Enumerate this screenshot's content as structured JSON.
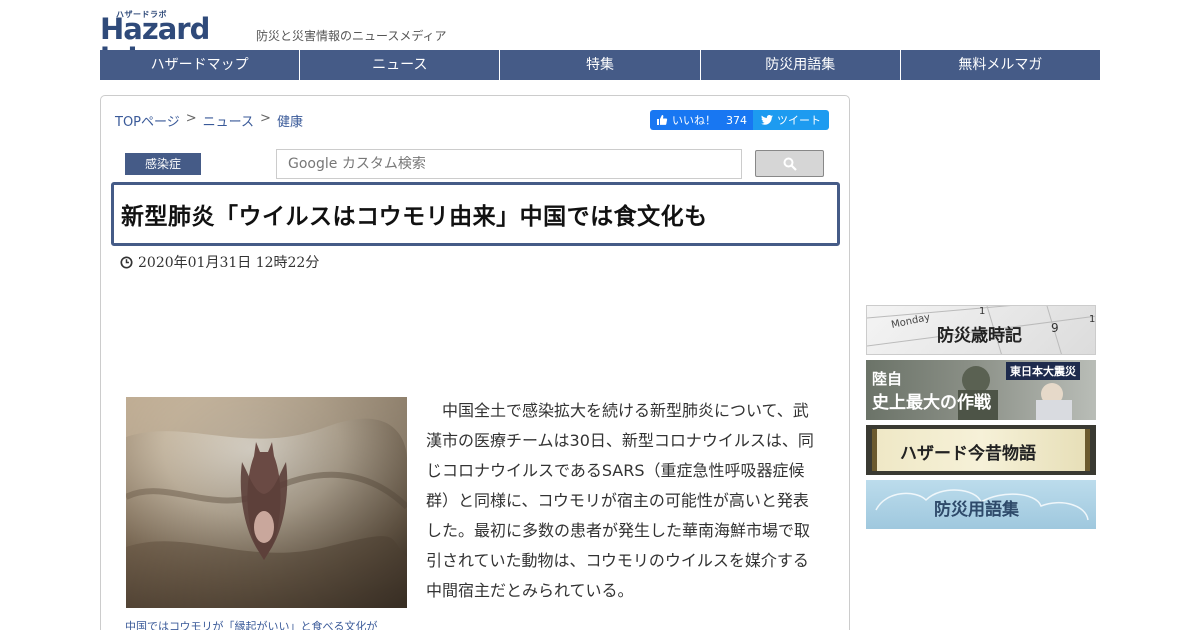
{
  "site": {
    "logo_kana": "ハザードラボ",
    "logo_text": "Hazard lab",
    "tagline": "防災と災害情報のニュースメディア"
  },
  "nav": {
    "items": [
      {
        "label": "ハザードマップ"
      },
      {
        "label": "ニュース"
      },
      {
        "label": "特集"
      },
      {
        "label": "防災用語集"
      },
      {
        "label": "無料メルマガ"
      }
    ]
  },
  "breadcrumb": {
    "items": [
      "TOPページ",
      "ニュース",
      "健康"
    ],
    "separator": ">"
  },
  "social": {
    "fb_label": "いいね！",
    "fb_count": "374",
    "tw_label": "ツイート"
  },
  "article": {
    "category": "感染症",
    "title": "新型肺炎「ウイルスはコウモリ由来」中国では食文化も",
    "date": "2020年01月31日 12時22分",
    "caption": "中国ではコウモリが「縁起がいい」と食べる文化が",
    "body": "中国全土で感染拡大を続ける新型肺炎について、武漢市の医療チームは30日、新型コロナウイルスは、同じコロナウイルスであるSARS（重症急性呼吸器症候群）と同様に、コウモリが宿主の可能性が高いと発表した。最初に多数の患者が発生した華南海鮮市場で取引されていた動物は、コウモリのウイルスを媒介する中間宿主だとみられている。"
  },
  "search": {
    "placeholder": "Google カスタム検索"
  },
  "sidebar": {
    "banners": [
      {
        "title": "防災歳時記",
        "sub": "Monday"
      },
      {
        "title_line1": "陸自",
        "title_line2": "史上最大の作戦",
        "badge": "東日本大震災"
      },
      {
        "title": "ハザード今昔物語"
      },
      {
        "title": "防災用語集"
      }
    ]
  },
  "colors": {
    "nav_bg": "#455b87",
    "link": "#3a5a99",
    "fb": "#1877f2",
    "twitter": "#1d9bf0"
  }
}
